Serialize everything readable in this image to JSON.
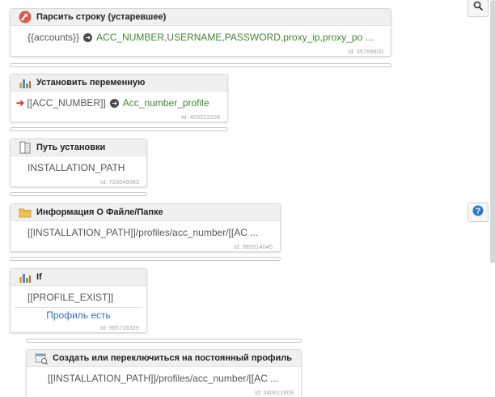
{
  "blocks": [
    {
      "title": "Парсить строку (устаревшее)",
      "line_var": "{{accounts}}",
      "line_value": "ACC_NUMBER,USERNAME,PASSWORD,proxy_ip,proxy_po ...",
      "id": "Id: 35789800",
      "icon": "regex-icon"
    },
    {
      "title": "Установить переменную",
      "line_var": "[[ACC_NUMBER]]",
      "line_value": "Acc_number_profile",
      "id": "Id: 403323208",
      "icon": "chart-icon"
    },
    {
      "title": "Путь установки",
      "line_value": "INSTALLATION_PATH",
      "id": "Id: 723649083",
      "icon": "document-icon"
    },
    {
      "title": "Информация О Файле/Папке",
      "line_value": "[[INSTALLATION_PATH]]/profiles/acc_number/[[AC ...",
      "id": "Id: 989314045",
      "icon": "folder-icon"
    },
    {
      "title": "If",
      "line_value": "[[PROFILE_EXIST]]",
      "branch_label": "Профиль есть",
      "id": "Id: 965716329",
      "icon": "chart-icon"
    },
    {
      "title": "Создать или переключиться на постоянный профиль",
      "line_value": "[[INSTALLATION_PATH]]/profiles/acc_number/[[AC ...",
      "id": "Id: 340612609",
      "icon": "profile-icon"
    }
  ],
  "sidebar": {
    "search_icon": "search-icon",
    "help_icon": "help-icon"
  },
  "colors": {
    "value_green": "#3e8a2e",
    "arrow_red": "#d23b2e",
    "link_blue": "#2f6fb5"
  }
}
